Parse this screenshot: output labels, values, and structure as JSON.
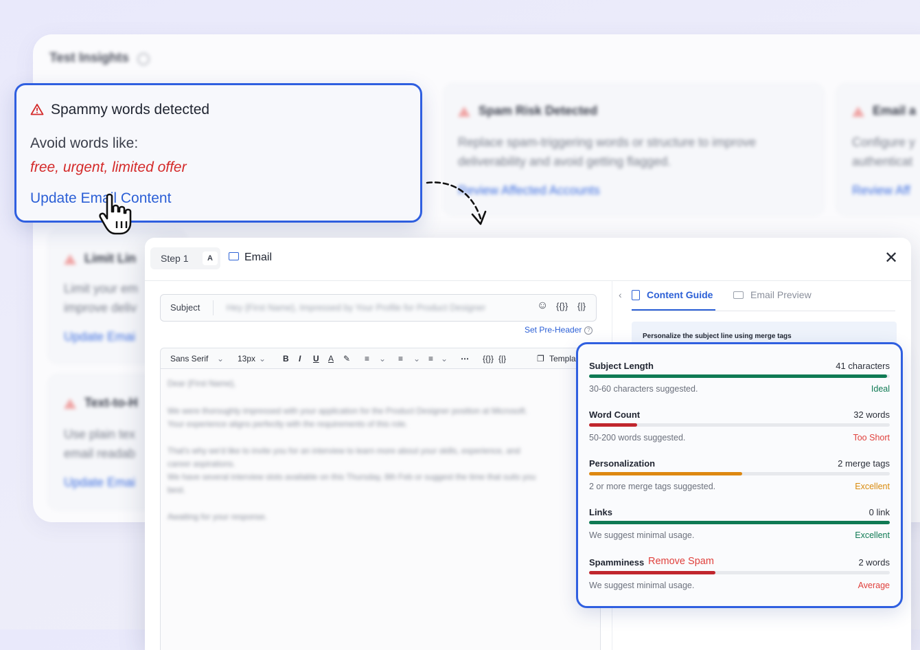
{
  "insights": {
    "title": "Test Insights",
    "spam_card": {
      "title": "Spammy words detected",
      "avoid_label": "Avoid words like:",
      "words": "free, urgent, limited offer",
      "link": "Update Email Content"
    },
    "bg_cards": [
      {
        "title": "Spam Risk Detected",
        "desc_1": "Replace spam-triggering words or structure to improve",
        "desc_2": "deliverability and avoid getting flagged.",
        "link": "Review Affected Accounts"
      },
      {
        "title": "Email a",
        "desc_1": "Configure y",
        "desc_2": "authenticat",
        "link": "Review Aff"
      },
      {
        "title": "Limit Lin",
        "desc_1": "Limit your em",
        "desc_2": "improve deliv",
        "link": "Update Emai"
      },
      {
        "title": "Text-to-H",
        "desc_1": "Use plain tex",
        "desc_2": "email readab",
        "link": "Update Emai"
      }
    ]
  },
  "editor": {
    "step_label": "Step 1",
    "step_variant": "A",
    "tab_label": "Email",
    "subject_label": "Subject",
    "subject_value": "Hey {First Name}, Impressed by Your Profile for Product Designer",
    "merge_icon_1": "{{}}",
    "merge_icon_2": "{|}",
    "preheader_link": "Set Pre-Header",
    "toolbar": {
      "font": "Sans Serif",
      "size": "13px",
      "bold": "B",
      "italic": "I",
      "underline": "U",
      "color": "A",
      "template": "Templa"
    },
    "body": [
      "Dear {First Name},",
      "We were thoroughly impressed with your application for the Product Designer position at Microsoft. Your experience aligns perfectly with the requirements of this role.",
      "That's why we'd like to invite you for an interview to learn more about your skills, experience, and career aspirations.",
      "We have several interview slots available on this Thursday, 8th Feb or suggest the time that suits you best.",
      "Awaiting for your response."
    ]
  },
  "guide": {
    "tab_active": "Content Guide",
    "tab_other": "Email Preview",
    "tip": "Personalize the subject line using merge tags",
    "remove_spam": "Remove Spam",
    "metrics": [
      {
        "name": "Subject Length",
        "value": "41 characters",
        "hint": "30-60 characters suggested.",
        "status": "Ideal",
        "level": 0.99,
        "color": "#0f7a54"
      },
      {
        "name": "Word Count",
        "value": "32 words",
        "hint": "50-200 words suggested.",
        "status": "Too Short",
        "level": 0.16,
        "color": "#c0262d"
      },
      {
        "name": "Personalization",
        "value": "2 merge tags",
        "hint": "2 or more merge tags suggested.",
        "status": "Excellent",
        "level": 0.51,
        "color": "#dd8812"
      },
      {
        "name": "Links",
        "value": "0 link",
        "hint": "We suggest minimal usage.",
        "status": "Excellent",
        "level": 1.0,
        "color": "#0f7a54"
      },
      {
        "name": "Spamminess",
        "value": "2 words",
        "hint": "We suggest minimal usage.",
        "status": "Average",
        "level": 0.42,
        "color": "#c0262d"
      }
    ],
    "status_colors": {
      "Ideal": "#0f7a54",
      "Too Short": "#e0403c",
      "Excellent_orange": "#d98a0c",
      "Excellent_green": "#0f7a54",
      "Average": "#e0403c"
    }
  }
}
